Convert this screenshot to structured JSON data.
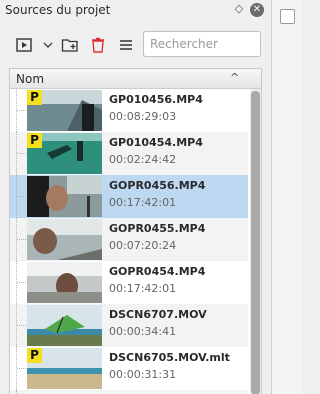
{
  "panel": {
    "title": "Sources du projet",
    "float_icon": "◇",
    "close_icon": "✕"
  },
  "toolbar": {
    "search_placeholder": "Rechercher"
  },
  "tree": {
    "column_header": "Nom",
    "sort_indicator": "^",
    "clips": [
      {
        "name": "GP010456.MP4",
        "duration": "00:08:29:03",
        "badge": "P"
      },
      {
        "name": "GP010454.MP4",
        "duration": "00:02:24:42",
        "badge": "P"
      },
      {
        "name": "GOPR0456.MP4",
        "duration": "00:17:42:01",
        "badge": "",
        "selected": true
      },
      {
        "name": "GOPR0455.MP4",
        "duration": "00:07:20:24",
        "badge": ""
      },
      {
        "name": "GOPR0454.MP4",
        "duration": "00:17:42:01",
        "badge": ""
      },
      {
        "name": "DSCN6707.MOV",
        "duration": "00:00:34:41",
        "badge": ""
      },
      {
        "name": "DSCN6705.MOV.mlt",
        "duration": "00:00:31:31",
        "badge": "P"
      }
    ]
  },
  "colors": {
    "selection": "#bcd9f1",
    "proxy_badge": "#f2e01e"
  }
}
